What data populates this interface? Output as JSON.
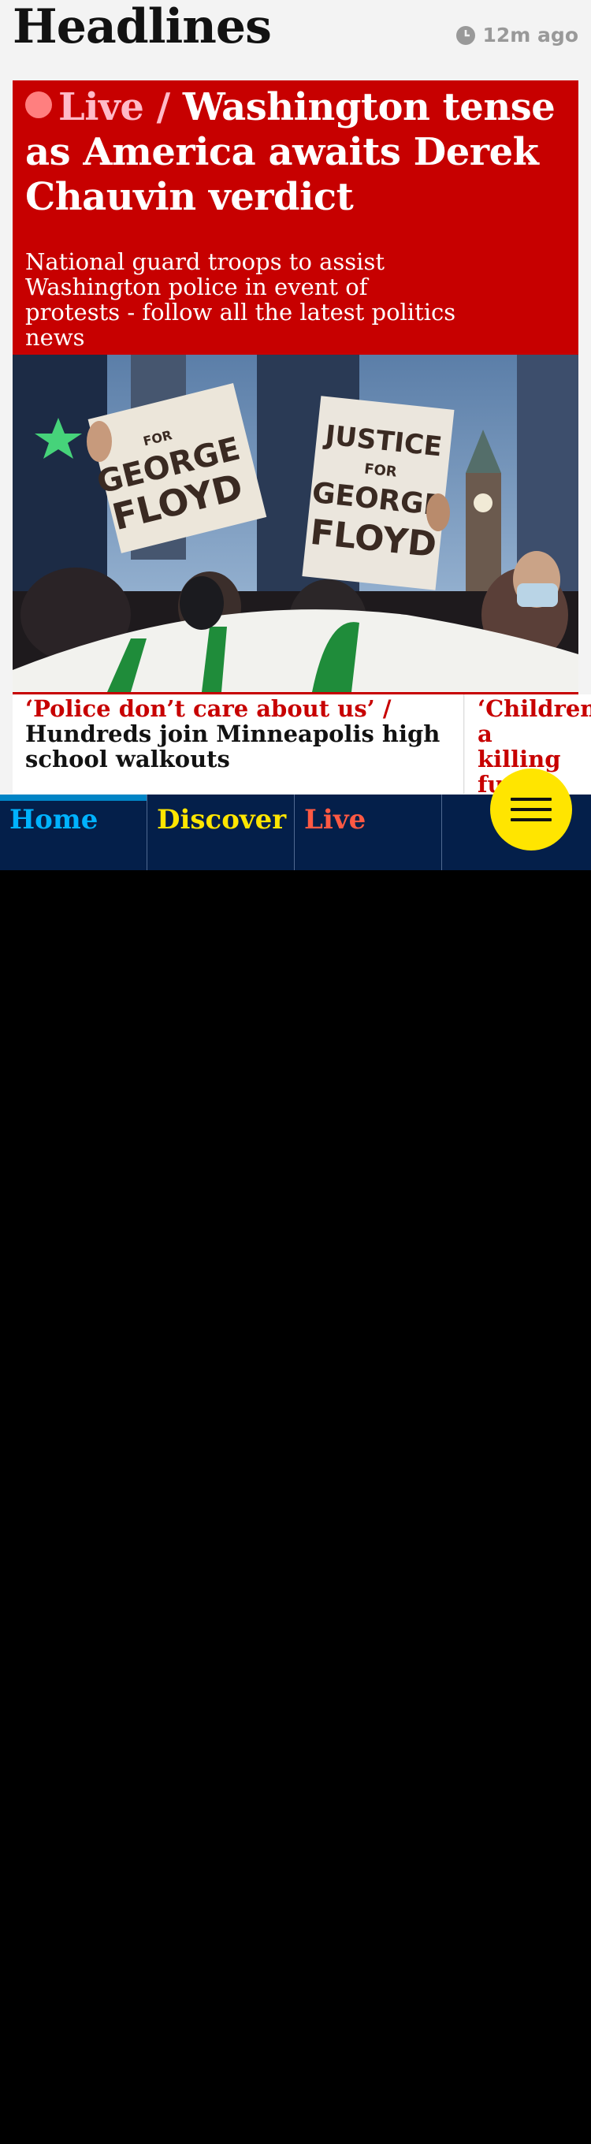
{
  "header": {
    "title": "Headlines",
    "timestamp": "12m ago",
    "timestamp_icon": "clock-icon"
  },
  "top_story": {
    "kicker": "Live /",
    "headline": "Washington tense as America awaits Derek Chauvin verdict",
    "standfirst": "National guard troops to assist Washington police in event of protests - follow all the latest politics news",
    "image": {
      "sign_left_lines": [
        "FOR",
        "GEORGE",
        "FLOYD"
      ],
      "sign_right_lines": [
        "JUSTICE",
        "FOR",
        "GEORGE",
        "FLOYD"
      ]
    },
    "background_color": "#c70000",
    "kicker_color": "#ffbac8"
  },
  "sublinks": [
    {
      "kicker": "‘Police don’t care about us’ /",
      "headline": "Hundreds join Minneapolis high school walkouts"
    },
    {
      "kicker": "‘Children a killing fue schools",
      "headline": ""
    }
  ],
  "bottom_nav": {
    "tabs": [
      {
        "label": "Home",
        "active": true
      },
      {
        "label": "Discover",
        "active": false
      },
      {
        "label": "Live",
        "active": false
      },
      {
        "label": "",
        "active": false
      }
    ],
    "menu_icon": "hamburger-menu-icon",
    "background_color": "#041f4a",
    "menu_color": "#ffe500"
  }
}
